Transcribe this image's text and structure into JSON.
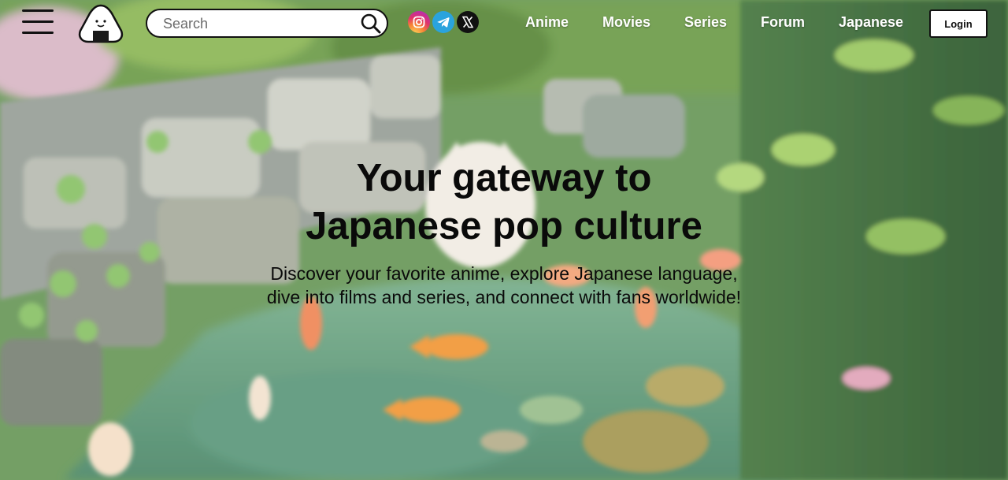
{
  "header": {
    "search": {
      "placeholder": "Search",
      "value": ""
    },
    "social": [
      "instagram-icon",
      "telegram-icon",
      "x-icon"
    ],
    "nav": [
      {
        "label": "Anime"
      },
      {
        "label": "Movies"
      },
      {
        "label": "Series"
      },
      {
        "label": "Forum"
      },
      {
        "label": "Japanese"
      }
    ],
    "login_label": "Login"
  },
  "hero": {
    "title_line1": "Your gateway to",
    "title_line2": "Japanese pop culture",
    "subtitle": "Discover your favorite anime, explore Japanese language, dive into films and series, and connect with fans worldwide!"
  },
  "colors": {
    "text": "#0a0a0a",
    "nav_text": "#ffffff",
    "telegram": "#2aa3dd",
    "pond_green": "#6fa386"
  }
}
